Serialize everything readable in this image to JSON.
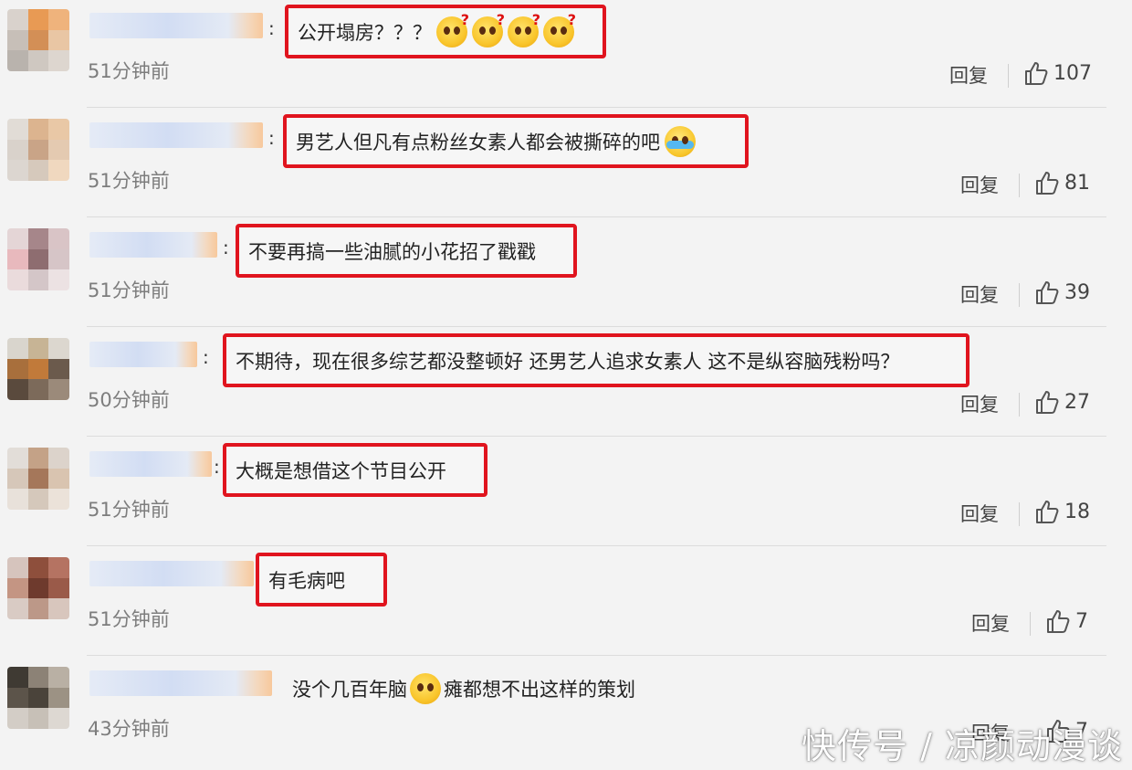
{
  "colors": {
    "highlight_border": "#e0141e",
    "background": "#f3f3f3",
    "time_text": "#7d7d7d"
  },
  "comments": [
    {
      "text": "公开塌房？？？",
      "time": "51分钟前",
      "reply": "回复",
      "likes": "107",
      "emoji": "dizzy-face-icon"
    },
    {
      "text": "男艺人但凡有点粉丝女素人都会被撕碎的吧",
      "time": "51分钟前",
      "reply": "回复",
      "likes": "81",
      "emoji": "laugh-cry-icon"
    },
    {
      "text": "不要再搞一些油腻的小花招了戳戳",
      "time": "51分钟前",
      "reply": "回复",
      "likes": "39"
    },
    {
      "text": "不期待，现在很多综艺都没整顿好 还男艺人追求女素人 这不是纵容脑残粉吗？",
      "time": "50分钟前",
      "reply": "回复",
      "likes": "27"
    },
    {
      "text": "大概是想借这个节目公开",
      "time": "51分钟前",
      "reply": "回复",
      "likes": "18"
    },
    {
      "text": "有毛病吧",
      "time": "51分钟前",
      "reply": "回复",
      "likes": "7"
    },
    {
      "text_before": "没个几百年脑",
      "text_after": "瘫都想不出这样的策划",
      "time": "43分钟前",
      "reply": "回复",
      "likes": "7",
      "emoji": "pleading-face-icon"
    }
  ],
  "watermark": "快传号 / 凉颜动漫谈"
}
